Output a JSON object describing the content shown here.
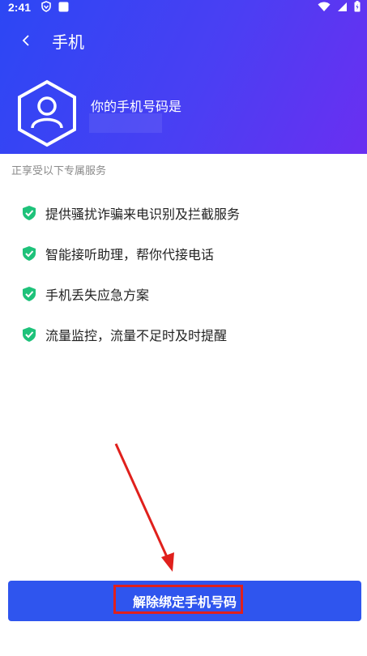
{
  "status_bar": {
    "time": "2:41"
  },
  "app_bar": {
    "title": "手机"
  },
  "profile": {
    "phone_label": "你的手机号码是",
    "phone_value": ""
  },
  "services": {
    "section_label": "正享受以下专属服务",
    "items": [
      {
        "label": "提供骚扰诈骗来电识别及拦截服务"
      },
      {
        "label": "智能接听助理，帮你代接电话"
      },
      {
        "label": "手机丢失应急方案"
      },
      {
        "label": "流量监控，流量不足时及时提醒"
      }
    ]
  },
  "footer": {
    "unbind_label": "解除绑定手机号码"
  },
  "colors": {
    "header_gradient_start": "#2c47f4",
    "header_gradient_end": "#6a2ff1",
    "check_green": "#1ec27a",
    "button_blue": "#2f55ee",
    "highlight_red": "#e0201c"
  }
}
